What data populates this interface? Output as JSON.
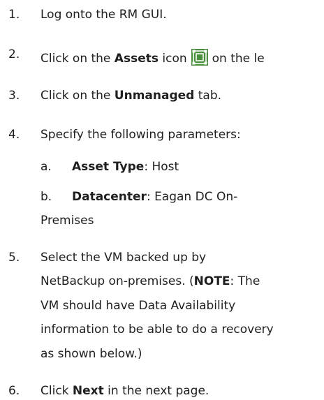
{
  "steps": [
    {
      "number": "1.",
      "text": "Log onto the RM GUI."
    },
    {
      "number": "2.",
      "pre": "Click on the ",
      "bold": "Assets",
      "mid": " icon",
      "icon": "assets-icon",
      "post": "on the le"
    },
    {
      "number": "3.",
      "pre": "Click on the ",
      "bold": "Unmanaged",
      "post": " tab."
    },
    {
      "number": "4.",
      "text": "Specify the following parameters:",
      "subs": [
        {
          "letter": "a.",
          "bold": "Asset Type",
          "text": ": Host"
        },
        {
          "letter": "b.",
          "bold": "Datacenter",
          "text": ": Eagan DC On-",
          "cont": "Premises"
        }
      ]
    },
    {
      "number": "5.",
      "lines": [
        "Select the VM backed up by",
        "NetBackup on-premises. (",
        "VM should have Data Availability",
        "information to be able to do a recovery",
        "as shown below.)"
      ],
      "note_bold": "NOTE",
      "note_rest": ": The"
    },
    {
      "number": "6.",
      "pre": "Click ",
      "bold": "Next",
      "post": " in the next page."
    }
  ],
  "colors": {
    "text": "#1f1f1f",
    "icon_bg": "#4a8f3c"
  }
}
